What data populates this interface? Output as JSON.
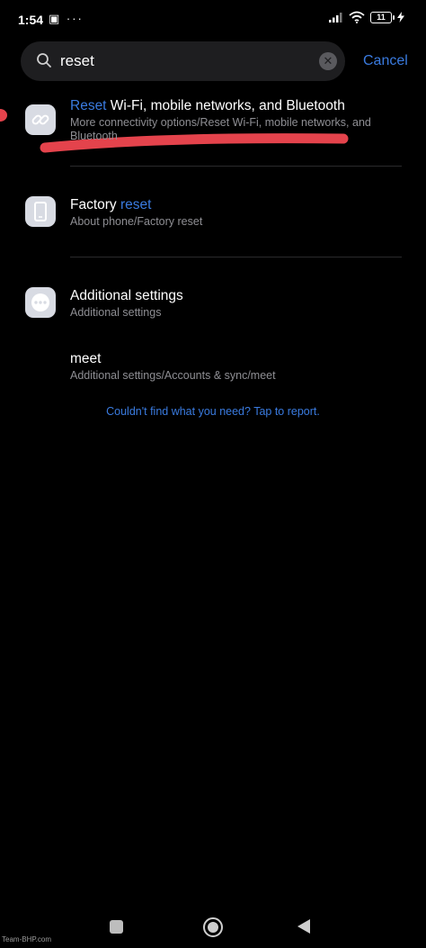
{
  "status_bar": {
    "time": "1:54",
    "left_icons": "▣ ···",
    "battery": "11"
  },
  "search": {
    "query": "reset",
    "cancel_label": "Cancel"
  },
  "results": [
    {
      "title_highlight": "Reset",
      "title_rest": " Wi-Fi, mobile networks, and Bluetooth",
      "subtitle": "More connectivity options/Reset Wi-Fi, mobile networks, and Bluetooth",
      "icon": "link-icon"
    },
    {
      "title_prefix": "Factory ",
      "title_highlight": "reset",
      "subtitle": "About phone/Factory reset",
      "icon": "phone-icon"
    },
    {
      "title": "Additional settings",
      "subtitle": "Additional settings",
      "icon": "more-dots-icon"
    },
    {
      "title": "meet",
      "subtitle": "Additional settings/Accounts & sync/meet"
    }
  ],
  "report_link": "Couldn't find what you need? Tap to report.",
  "watermark": "Team-BHP.com",
  "colors": {
    "background": "#000000",
    "accent": "#3a7be0",
    "annotation": "#e4434c",
    "subtitle": "#8e8e93"
  }
}
